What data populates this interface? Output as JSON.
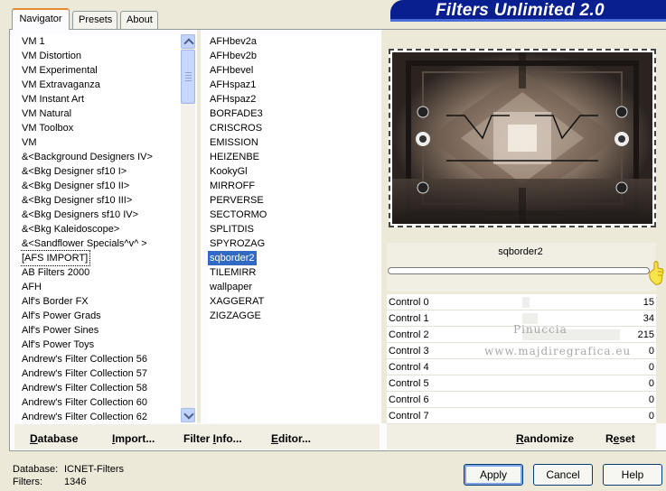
{
  "tabs": [
    {
      "label": "Navigator",
      "active": true
    },
    {
      "label": "Presets",
      "active": false
    },
    {
      "label": "About",
      "active": false
    }
  ],
  "banner": {
    "title": "Filters Unlimited 2.0"
  },
  "categories": [
    "VM 1",
    "VM Distortion",
    "VM Experimental",
    "VM Extravaganza",
    "VM Instant Art",
    "VM Natural",
    "VM Toolbox",
    "VM",
    "&<Background Designers IV>",
    "&<Bkg Designer sf10 I>",
    "&<Bkg Designer sf10 II>",
    "&<Bkg Designer sf10 III>",
    "&<Bkg Designers sf10 IV>",
    "&<Bkg Kaleidoscope>",
    "&<Sandflower Specials^v^ >",
    "[AFS IMPORT]",
    "AB Filters 2000",
    "AFH",
    "Alf's Border FX",
    "Alf's Power Grads",
    "Alf's Power Sines",
    "Alf's Power Toys",
    "Andrew's Filter Collection 56",
    "Andrew's Filter Collection 57",
    "Andrew's Filter Collection 58",
    "Andrew's Filter Collection 60",
    "Andrew's Filter Collection 62"
  ],
  "selected_category_index": 15,
  "filters": [
    "AFHbev2a",
    "AFHbev2b",
    "AFHbevel",
    "AFHspaz1",
    "AFHspaz2",
    "BORFADE3",
    "CRISCROS",
    "EMISSION",
    "HEIZENBE",
    "KookyGl",
    "MIRROFF",
    "PERVERSE",
    "SECTORMO",
    "SPLITDIS",
    "SPYROZAG",
    "sqborder2",
    "TILEMIRR",
    "wallpaper",
    "XAGGERAT",
    "ZIGZAGGE"
  ],
  "selected_filter_index": 15,
  "filter_title": "sqborder2",
  "controls": [
    {
      "label": "Control 0",
      "value": "15"
    },
    {
      "label": "Control 1",
      "value": "34"
    },
    {
      "label": "Control 2",
      "value": "215"
    },
    {
      "label": "Control 3",
      "value": "0"
    },
    {
      "label": "Control 4",
      "value": "0"
    },
    {
      "label": "Control 5",
      "value": "0"
    },
    {
      "label": "Control 6",
      "value": "0"
    },
    {
      "label": "Control 7",
      "value": "0"
    }
  ],
  "watermark": {
    "line1": "Pinuccia",
    "line2": "www.majdiregrafica.eu"
  },
  "bottom_links": {
    "database": {
      "pre": "",
      "u": "D",
      "post": "atabase"
    },
    "import": {
      "pre": "",
      "u": "I",
      "post": "mport..."
    },
    "filter_info": {
      "pre": "Filter ",
      "u": "I",
      "post": "nfo..."
    },
    "editor": {
      "pre": "",
      "u": "E",
      "post": "ditor..."
    },
    "randomize": {
      "pre": "",
      "u": "R",
      "post": "andomize"
    },
    "reset": {
      "pre": "R",
      "u": "e",
      "post": "set"
    }
  },
  "status": {
    "database_label": "Database:",
    "database_value": "ICNET-Filters",
    "filters_label": "Filters:",
    "filters_value": "1346"
  },
  "buttons": {
    "apply": "Apply",
    "cancel": "Cancel",
    "help": "Help"
  },
  "colors": {
    "selection": "#316ac5",
    "banner": "#0a1f8f",
    "tab_accent": "#e68b2c"
  }
}
